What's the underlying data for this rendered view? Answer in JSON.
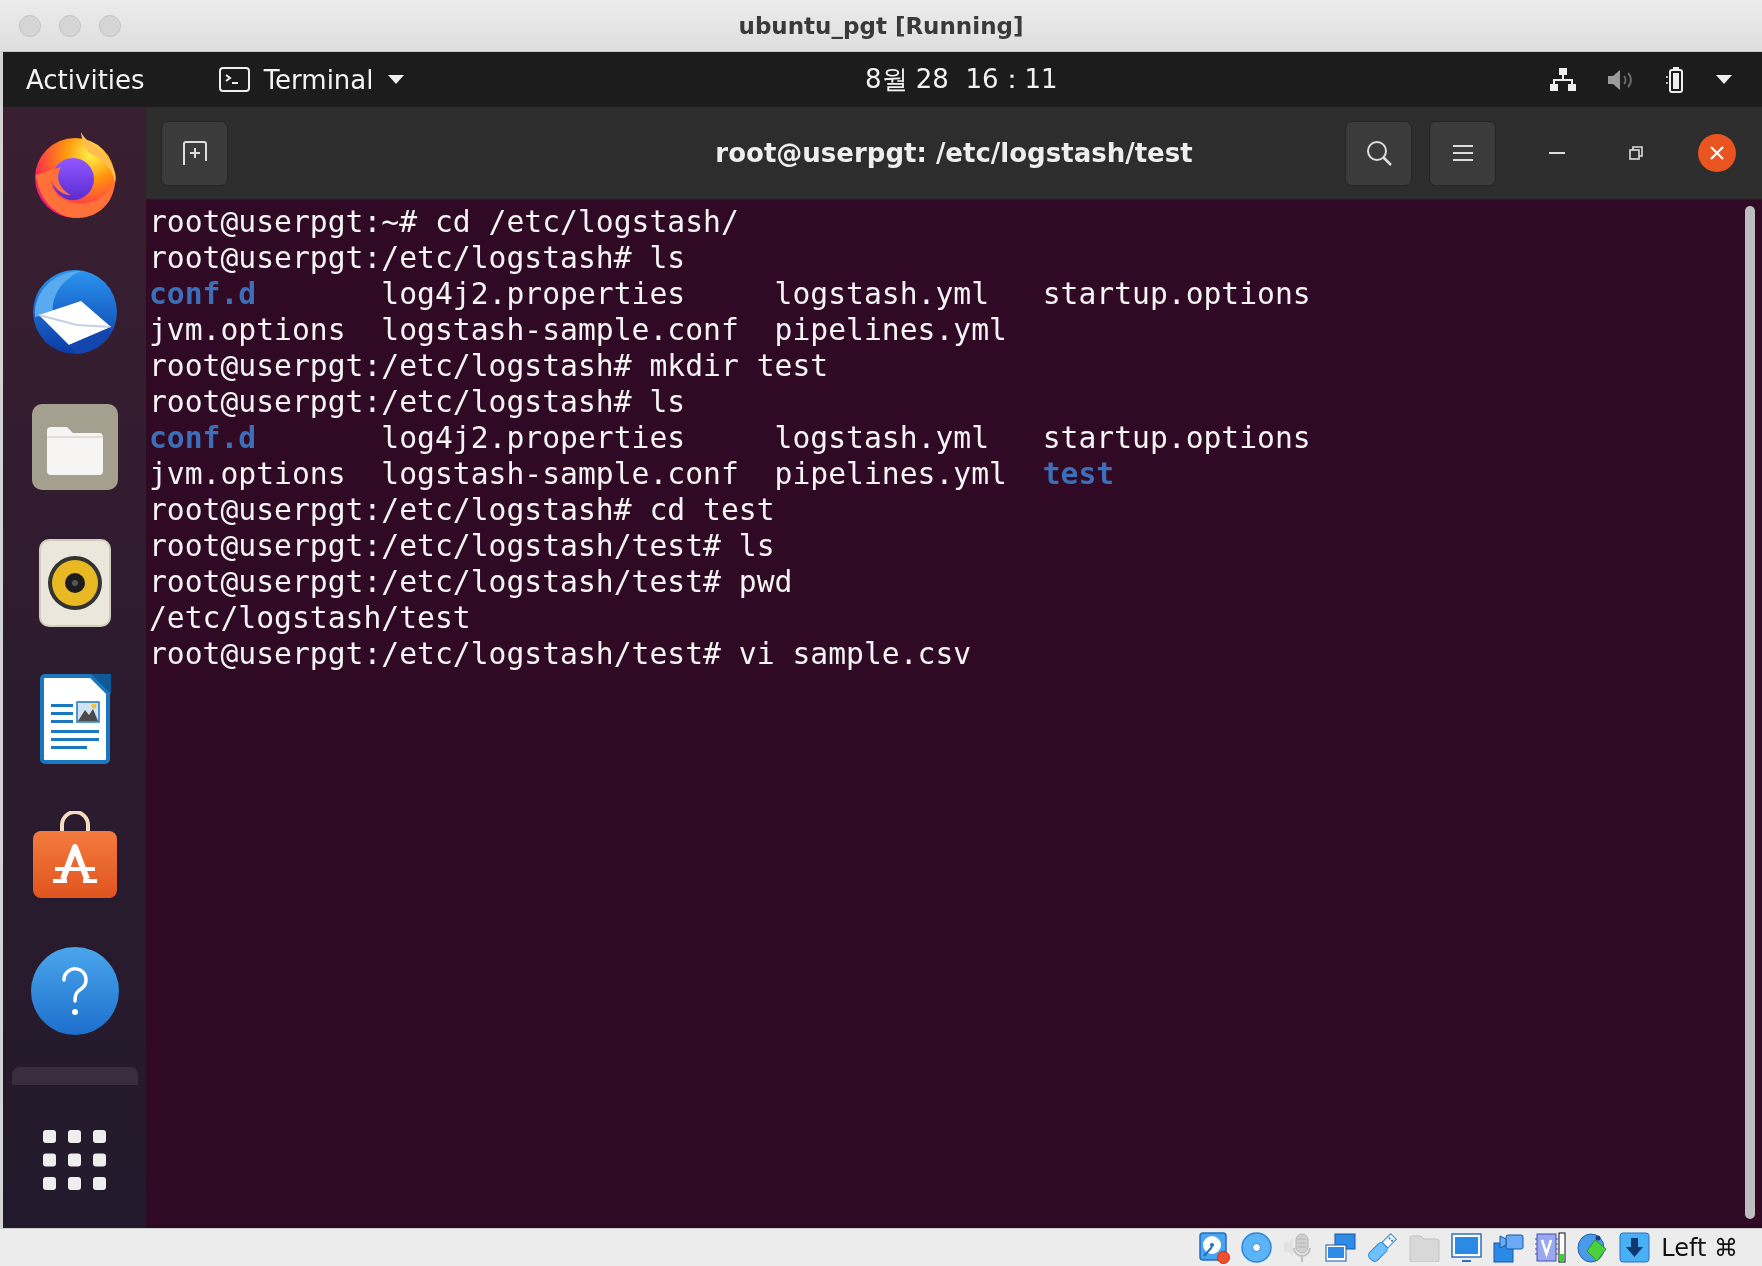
{
  "window": {
    "title": "ubuntu_pgt [Running]"
  },
  "top_bar": {
    "activities": "Activities",
    "app_menu": "Terminal",
    "clock": "8월 28  16：11"
  },
  "terminal": {
    "title": "root@userpgt: /etc/logstash/test",
    "lines": [
      {
        "kind": "text",
        "text": "root@userpgt:~# cd /etc/logstash/"
      },
      {
        "kind": "text",
        "text": "root@userpgt:/etc/logstash# ls"
      },
      {
        "kind": "listing",
        "entries": [
          {
            "kind": "directory",
            "name": "conf.d"
          },
          {
            "kind": "file",
            "name": "log4j2.properties"
          },
          {
            "kind": "file",
            "name": "logstash.yml"
          },
          {
            "kind": "file",
            "name": "startup.options"
          }
        ]
      },
      {
        "kind": "listing",
        "entries": [
          {
            "kind": "file",
            "name": "jvm.options"
          },
          {
            "kind": "file",
            "name": "logstash-sample.conf"
          },
          {
            "kind": "file",
            "name": "pipelines.yml"
          }
        ]
      },
      {
        "kind": "text",
        "text": "root@userpgt:/etc/logstash# mkdir test"
      },
      {
        "kind": "text",
        "text": "root@userpgt:/etc/logstash# ls"
      },
      {
        "kind": "listing",
        "entries": [
          {
            "kind": "directory",
            "name": "conf.d"
          },
          {
            "kind": "file",
            "name": "log4j2.properties"
          },
          {
            "kind": "file",
            "name": "logstash.yml"
          },
          {
            "kind": "file",
            "name": "startup.options"
          }
        ]
      },
      {
        "kind": "listing",
        "entries": [
          {
            "kind": "file",
            "name": "jvm.options"
          },
          {
            "kind": "file",
            "name": "logstash-sample.conf"
          },
          {
            "kind": "file",
            "name": "pipelines.yml"
          },
          {
            "kind": "directory",
            "name": "test"
          }
        ]
      },
      {
        "kind": "text",
        "text": "root@userpgt:/etc/logstash# cd test"
      },
      {
        "kind": "text",
        "text": "root@userpgt:/etc/logstash/test# ls"
      },
      {
        "kind": "text",
        "text": "root@userpgt:/etc/logstash/test# pwd"
      },
      {
        "kind": "text",
        "text": "/etc/logstash/test"
      },
      {
        "kind": "text",
        "text": "root@userpgt:/etc/logstash/test# vi sample.csv"
      }
    ]
  },
  "status_bar": {
    "host_key": "Left ⌘"
  }
}
